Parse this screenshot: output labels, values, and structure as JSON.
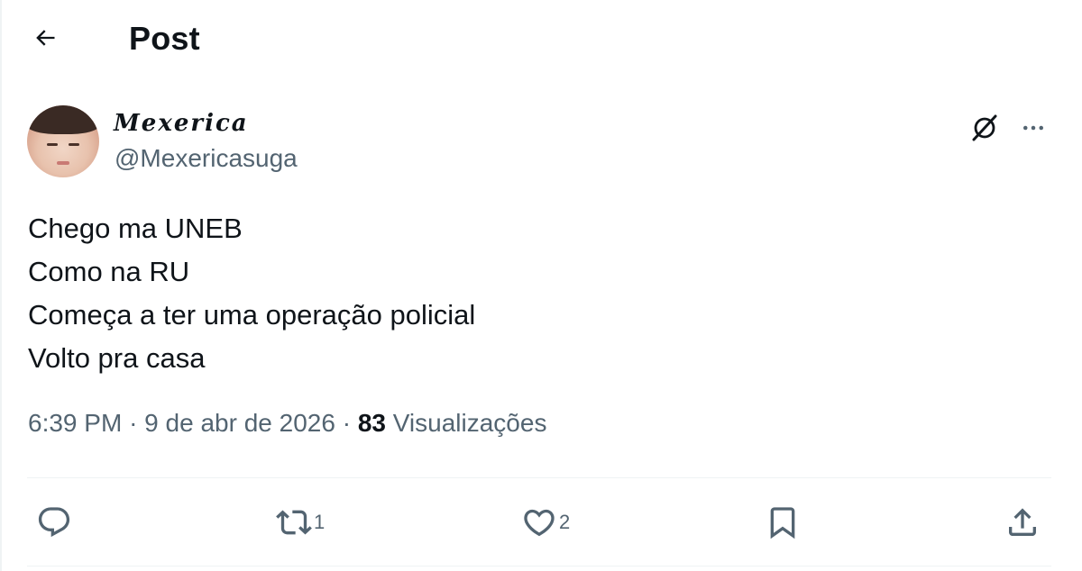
{
  "header": {
    "title": "Post",
    "back_icon": "arrow-left-icon"
  },
  "author": {
    "display_name": "𝑴𝒆𝒙𝒆𝒓𝒊𝒄𝒂",
    "handle": "@Mexericasuga"
  },
  "tweet": {
    "lines": [
      "Chego ma UNEB",
      "Como na RU",
      "Começa a ter uma operação policial",
      "Volto pra casa"
    ],
    "time": "6:39 PM",
    "separator": "·",
    "date": "9 de abr de 2026",
    "views_count": "83",
    "views_label": "Visualizações"
  },
  "actions": {
    "reply_count": "",
    "retweet_count": "1",
    "like_count": "2",
    "icons": [
      "reply-icon",
      "retweet-icon",
      "like-icon",
      "bookmark-icon",
      "share-icon"
    ]
  },
  "colors": {
    "text_primary": "#0f1419",
    "text_secondary": "#536471",
    "divider": "#eff3f4"
  }
}
